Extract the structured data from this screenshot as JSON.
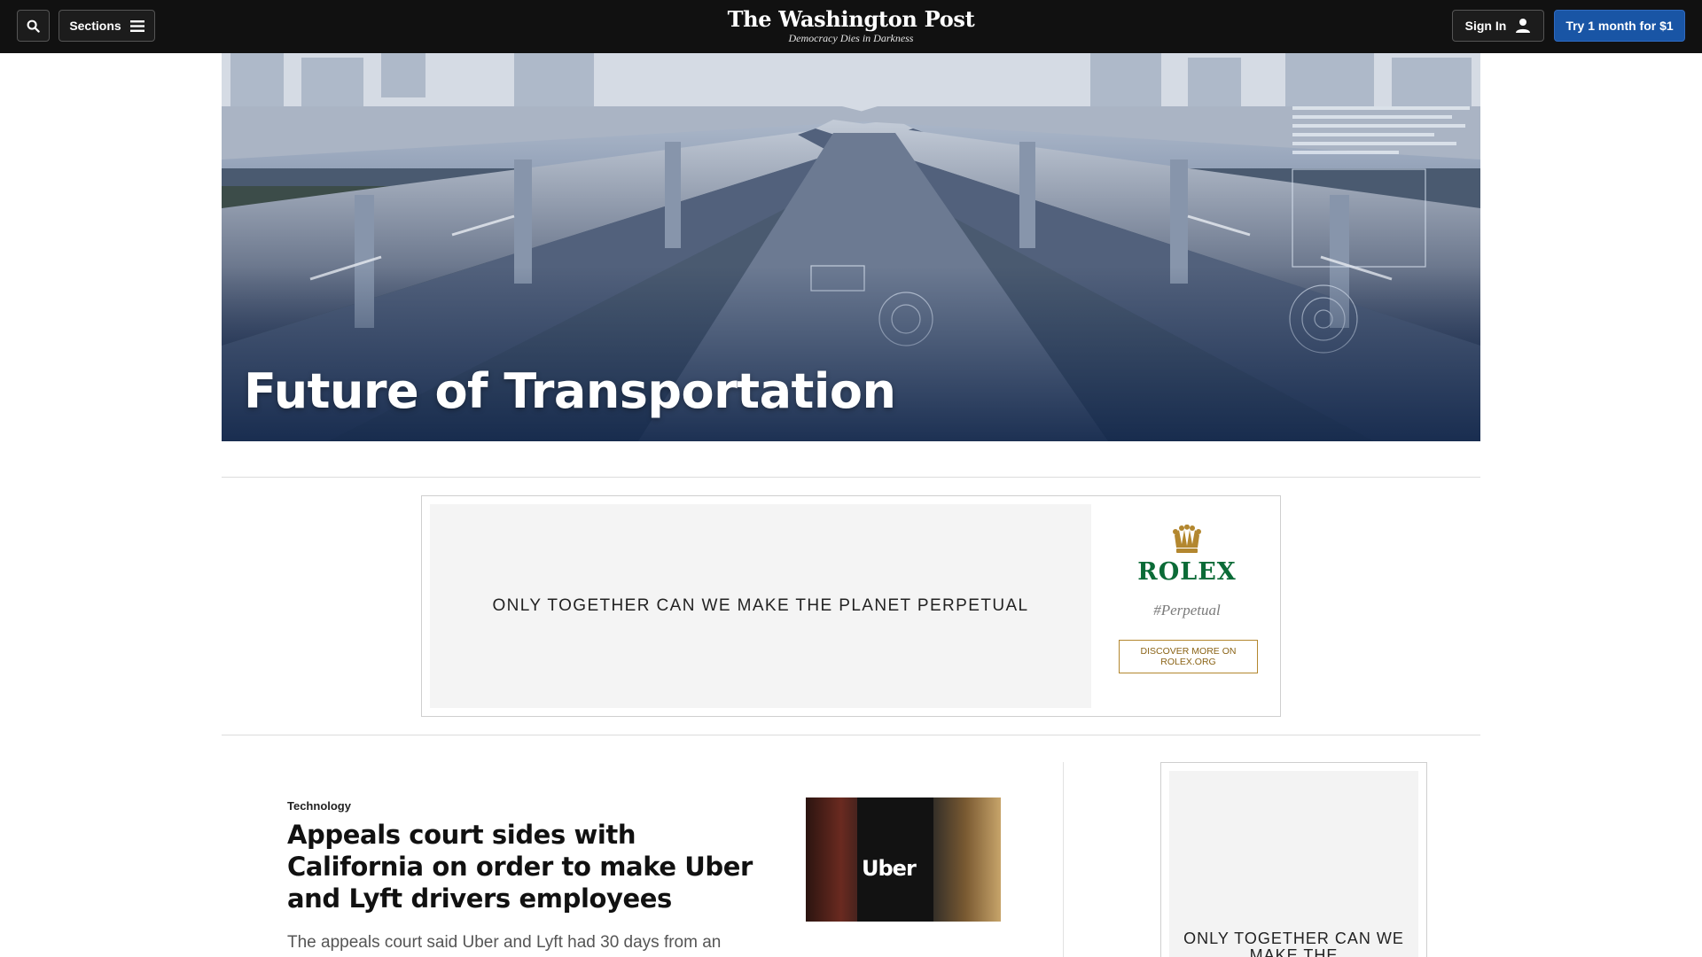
{
  "header": {
    "logo": "The Washington Post",
    "tagline": "Democracy Dies in Darkness",
    "sections_label": "Sections",
    "signin_label": "Sign In",
    "subscribe_label": "Try 1 month for $1"
  },
  "hero": {
    "title": "Future of Transportation"
  },
  "ad_banner": {
    "slogan": "ONLY TOGETHER CAN WE MAKE THE PLANET PERPETUAL",
    "brand": "ROLEX",
    "hashtag": "#Perpetual",
    "cta": "DISCOVER MORE ON ROLEX.ORG"
  },
  "article": {
    "kicker": "Technology",
    "headline": "Appeals court sides with California on order to make Uber and Lyft drivers employees",
    "blurb": "The appeals court said Uber and Lyft had 30 days from an",
    "thumbnail_text": "Uber"
  },
  "side_ad": {
    "slogan": "ONLY TOGETHER CAN WE MAKE THE"
  },
  "colors": {
    "topbar": "#111111",
    "subscribe_button": "#1955a5",
    "rolex_green": "#0b6b37",
    "rolex_gold": "#b3872f"
  }
}
